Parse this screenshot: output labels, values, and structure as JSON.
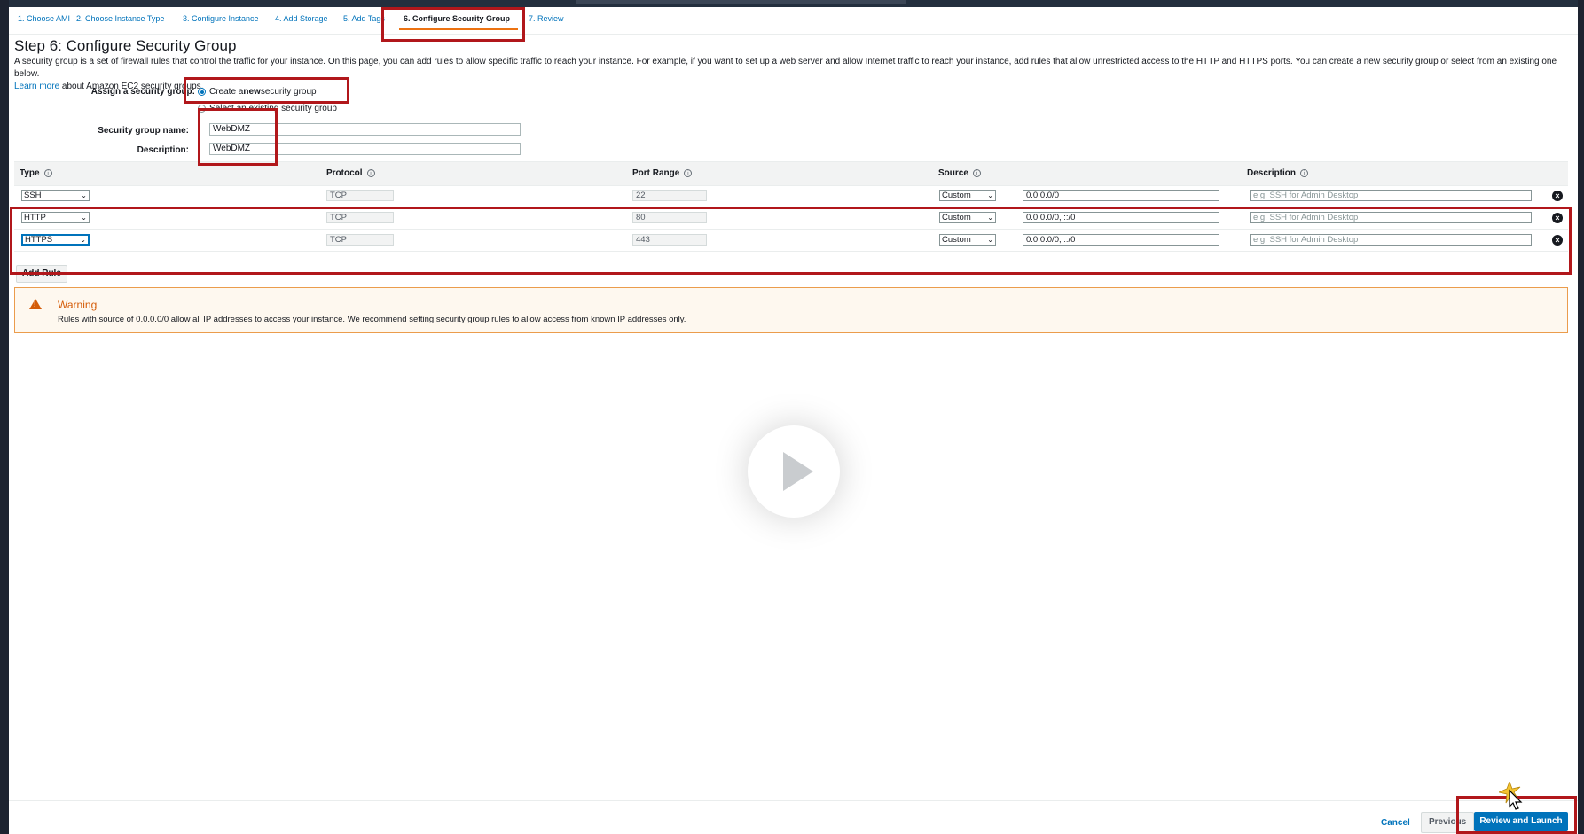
{
  "steps": [
    {
      "label": "1. Choose AMI"
    },
    {
      "label": "2. Choose Instance Type"
    },
    {
      "label": "3. Configure Instance"
    },
    {
      "label": "4. Add Storage"
    },
    {
      "label": "5. Add Tags"
    },
    {
      "label": "6. Configure Security Group"
    },
    {
      "label": "7. Review"
    }
  ],
  "page": {
    "title": "Step 6: Configure Security Group",
    "intro": "A security group is a set of firewall rules that control the traffic for your instance. On this page, you can add rules to allow specific traffic to reach your instance. For example, if you want to set up a web server and allow Internet traffic to reach your instance, add rules that allow unrestricted access to the HTTP and HTTPS ports. You can create a new security group or select from an existing one below.",
    "learn_more": "Learn more",
    "learn_more_tail": "about Amazon EC2 security groups."
  },
  "assign": {
    "label": "Assign a security group:",
    "option_new_pre": "Create a ",
    "option_new_bold": "new",
    "option_new_post": " security group",
    "option_existing": "Select an existing security group"
  },
  "form": {
    "name_label": "Security group name:",
    "name_value": "WebDMZ",
    "desc_label": "Description:",
    "desc_value": "WebDMZ"
  },
  "table": {
    "headers": {
      "type": "Type",
      "protocol": "Protocol",
      "port_range": "Port Range",
      "source": "Source",
      "description": "Description"
    },
    "info_glyph": "i",
    "remove_glyph": "×",
    "caret_glyph": "⌄",
    "rows": [
      {
        "type": "SSH",
        "protocol": "TCP",
        "port": "22",
        "source": "Custom",
        "cidr": "0.0.0.0/0",
        "desc_placeholder": "e.g. SSH for Admin Desktop"
      },
      {
        "type": "HTTP",
        "protocol": "TCP",
        "port": "80",
        "source": "Custom",
        "cidr": "0.0.0.0/0, ::/0",
        "desc_placeholder": "e.g. SSH for Admin Desktop"
      },
      {
        "type": "HTTPS",
        "protocol": "TCP",
        "port": "443",
        "source": "Custom",
        "cidr": "0.0.0.0/0, ::/0",
        "desc_placeholder": "e.g. SSH for Admin Desktop"
      }
    ],
    "add_rule": "Add Rule"
  },
  "warning": {
    "glyph": "!",
    "title": "Warning",
    "text": "Rules with source of 0.0.0.0/0 allow all IP addresses to access your instance. We recommend setting security group rules to allow access from known IP addresses only."
  },
  "footer": {
    "cancel": "Cancel",
    "previous": "Previous",
    "review_launch": "Review and Launch"
  },
  "colors": {
    "link": "#0073bb",
    "primary_button": "#0073bb",
    "warning": "#d45b07",
    "highlight": "#b1171b"
  },
  "icons": [
    "info-icon",
    "remove-rule-icon",
    "warning-icon",
    "play-icon",
    "mouse-cursor-icon"
  ]
}
